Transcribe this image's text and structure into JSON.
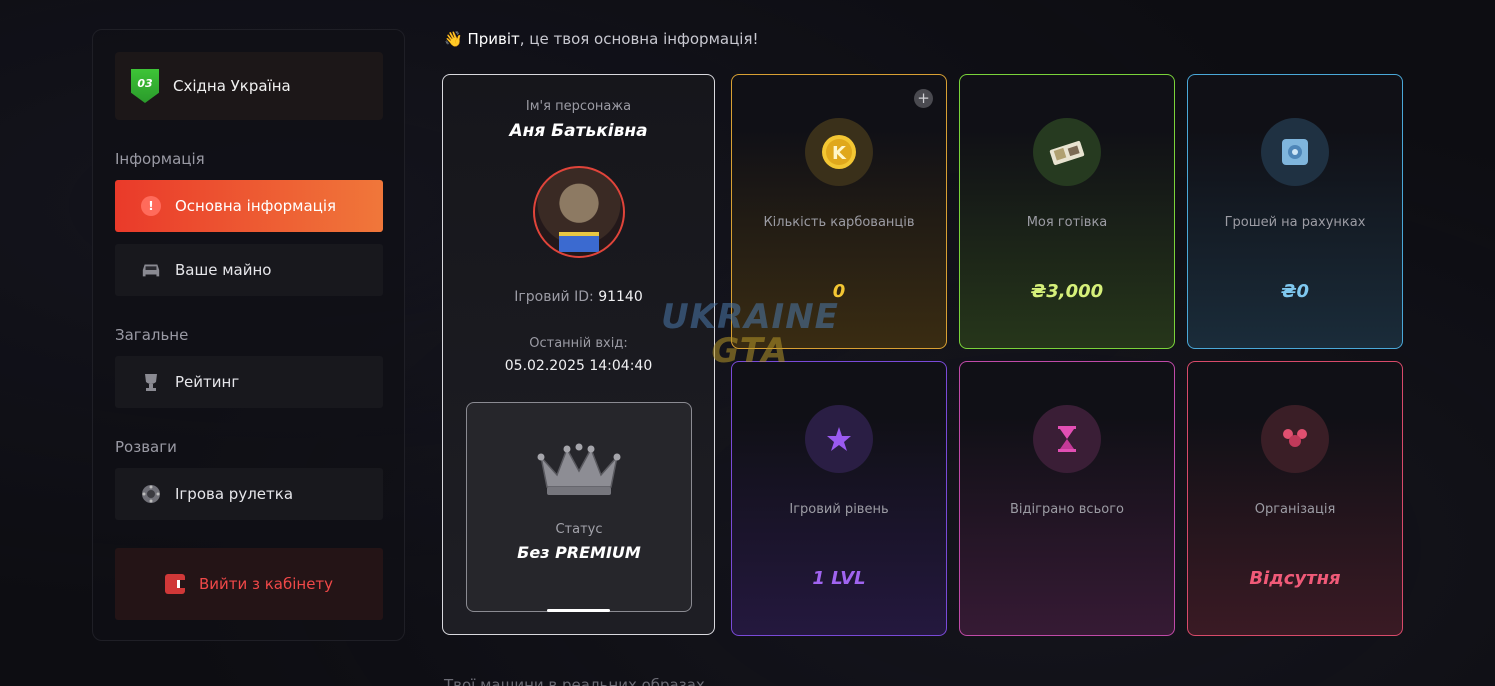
{
  "sidebar": {
    "region": {
      "badge": "03",
      "name": "Східна Україна"
    },
    "sections": [
      {
        "title": "Інформація"
      },
      {
        "title": "Загальне"
      },
      {
        "title": "Розваги"
      }
    ],
    "items": [
      {
        "label": "Основна інформація",
        "icon": "alert-icon"
      },
      {
        "label": "Ваше майно",
        "icon": "car-icon"
      },
      {
        "label": "Рейтинг",
        "icon": "trophy-icon"
      },
      {
        "label": "Ігрова рулетка",
        "icon": "roulette-icon"
      }
    ],
    "logout": {
      "label": "Вийти з кабінету",
      "icon": "exit-icon"
    }
  },
  "greeting": {
    "emoji": "👋",
    "bold": "Привіт",
    "rest": ", це твоя основна інформація!"
  },
  "profile": {
    "name_caption": "Ім'я персонажа",
    "name": "Аня Батьківна",
    "id_caption": "Ігровий ID:",
    "id": "91140",
    "last_login_caption": "Останній вхід:",
    "last_login": "05.02.2025 14:04:40",
    "status_caption": "Статус",
    "status": "Без PREMIUM"
  },
  "stats": [
    {
      "label": "Кількість карбованців",
      "value": "0",
      "color": "#f3c633",
      "icon": "coin-icon"
    },
    {
      "label": "Моя готівка",
      "value": "₴3,000",
      "color": "#d6f07a",
      "icon": "cash-icon"
    },
    {
      "label": "Грошей на рахунках",
      "value": "₴0",
      "color": "#7fc8ef",
      "icon": "safe-icon"
    },
    {
      "label": "Ігровий рівень",
      "value": "1 LVL",
      "color": "#a064f0",
      "icon": "star-icon"
    },
    {
      "label": "Відіграно всього",
      "value": "",
      "color": "#e24fb4",
      "icon": "hourglass-icon"
    },
    {
      "label": "Організація",
      "value": "Відсутня",
      "color": "#f05a78",
      "icon": "group-icon"
    }
  ],
  "watermark": {
    "line1": "UKRAINE",
    "line2": "GTA"
  },
  "bottom_text": "Твої машини в реальних образах"
}
